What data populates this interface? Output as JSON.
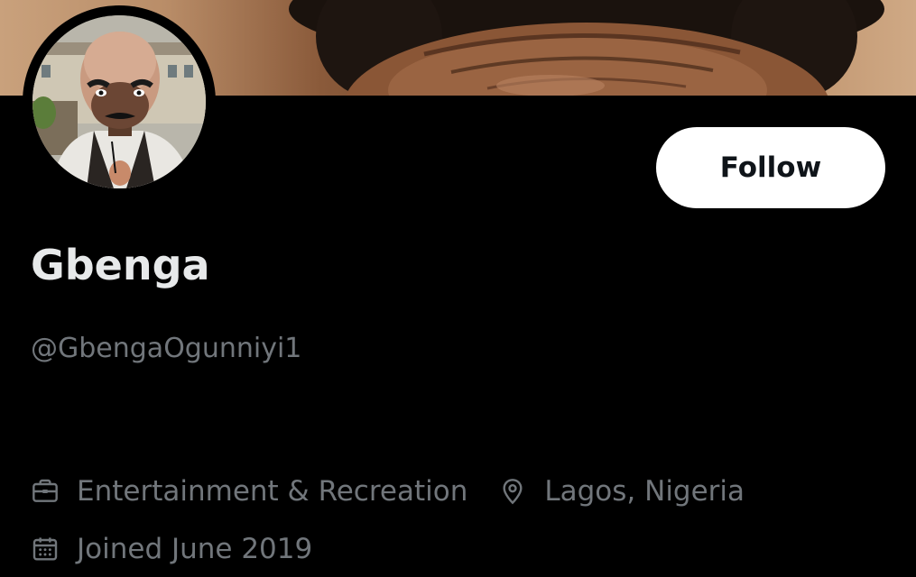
{
  "profile": {
    "display_name": "Gbenga",
    "handle": "@GbengaOgunniyi1",
    "category": "Entertainment & Recreation",
    "location": "Lagos, Nigeria",
    "joined": "Joined June 2019"
  },
  "actions": {
    "follow_label": "Follow"
  },
  "icons": {
    "category": "briefcase-icon",
    "location": "location-pin-icon",
    "joined": "calendar-icon"
  },
  "colors": {
    "background": "#000000",
    "primary_text": "#e7e9ea",
    "secondary_text": "#71767b",
    "follow_button_bg": "#ffffff",
    "follow_button_text": "#0f1419"
  }
}
